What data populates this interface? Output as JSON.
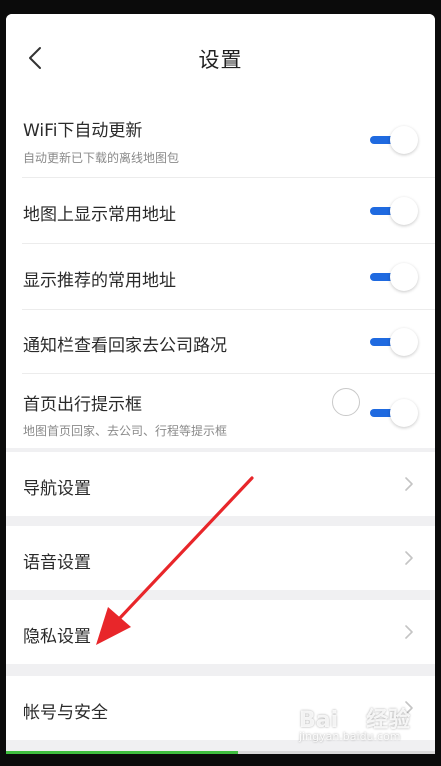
{
  "header": {
    "title": "设置"
  },
  "toggles": [
    {
      "title": "WiFi下自动更新",
      "subtitle": "自动更新已下载的离线地图包",
      "on": true
    },
    {
      "title": "地图上显示常用地址",
      "subtitle": "",
      "on": true
    },
    {
      "title": "显示推荐的常用地址",
      "subtitle": "",
      "on": true
    },
    {
      "title": "通知栏查看回家去公司路况",
      "subtitle": "",
      "on": true
    },
    {
      "title": "首页出行提示框",
      "subtitle": "地图首页回家、去公司、行程等提示框",
      "on": true
    }
  ],
  "nav_items": [
    {
      "title": "导航设置"
    },
    {
      "title": "语音设置"
    },
    {
      "title": "隐私设置"
    },
    {
      "title": "帐号与安全"
    }
  ],
  "progress": {
    "fraction": 0.54
  },
  "colors": {
    "accent": "#1f6ae0",
    "background": "#f0f0f2",
    "annotation_arrow": "#e8262a",
    "progress": "#3fbf3f"
  },
  "icons": {
    "back": "chevron-left-icon",
    "nav": "chevron-right-icon"
  },
  "watermark": {
    "url": "jingyan.baidu.com"
  }
}
